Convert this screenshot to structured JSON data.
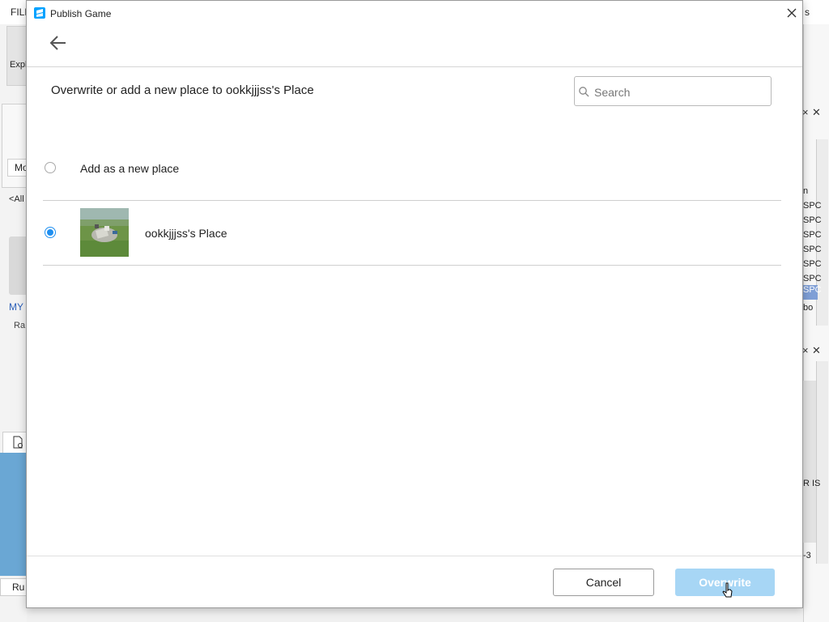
{
  "background": {
    "menu_file": "FILE",
    "menu_right": "s",
    "explorer_label": "Expl",
    "mo_label": "Mo",
    "all_label": "<All",
    "my_label": "MY",
    "ra_label": "Ra",
    "run_label": "Ru",
    "right_rows": [
      "n",
      "SPC",
      "SPC",
      "SPC",
      "SPC",
      "SPC",
      "SPC",
      "SPC",
      "bo",
      "R IS",
      "-3"
    ]
  },
  "dialog": {
    "title": "Publish Game",
    "heading": "Overwrite or add a new place to ookkjjjss's Place",
    "search": {
      "placeholder": "Search",
      "value": ""
    },
    "options": [
      {
        "label": "Add as a new place",
        "selected": false
      },
      {
        "label": "ookkjjjss's Place",
        "selected": true
      }
    ],
    "buttons": {
      "cancel": "Cancel",
      "overwrite": "Overwrite"
    },
    "accent_color": "#1f8ff0",
    "overwrite_button_color": "#a7d6f5"
  }
}
